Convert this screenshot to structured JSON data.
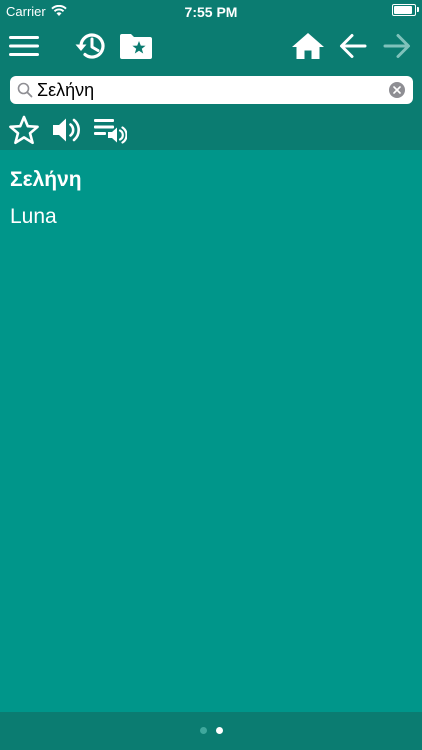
{
  "status_bar": {
    "carrier": "Carrier",
    "time": "7:55 PM",
    "battery_level": 0.95
  },
  "toolbar": {
    "icons": [
      "menu-icon",
      "history-icon",
      "bookmark-folder-icon",
      "home-icon",
      "back-arrow-icon",
      "forward-arrow-icon"
    ]
  },
  "search": {
    "value": "Σελήνη",
    "placeholder": ""
  },
  "actions": {
    "icons": [
      "star-icon",
      "speaker-icon",
      "playlist-audio-icon"
    ]
  },
  "entry": {
    "headword": "Σελήνη",
    "translation": "Luna"
  },
  "pager": {
    "page_count": 2,
    "current_page": 2
  },
  "colors": {
    "toolbar_bg": "#0b7c71",
    "content_bg": "#00968a",
    "text": "#ffffff",
    "disabled_icon": "#7fc2bb"
  }
}
